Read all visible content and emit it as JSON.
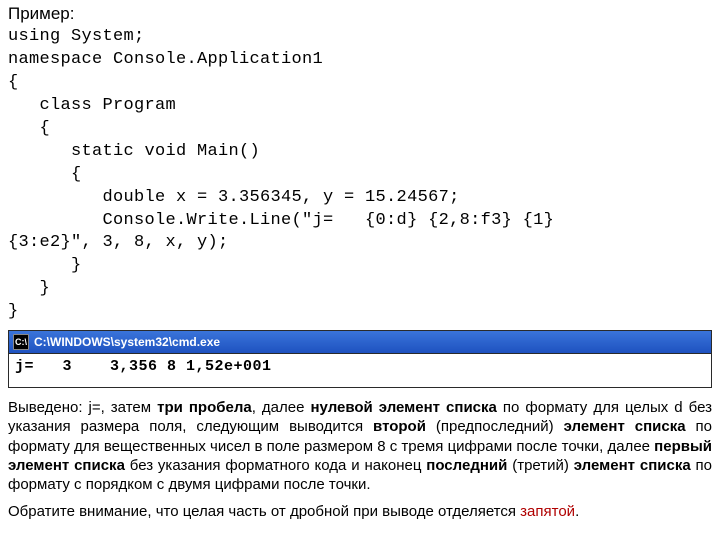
{
  "heading": "Пример:",
  "code": {
    "l1": "using System;",
    "l2": "namespace Console.Application1",
    "l3": "{",
    "l4": "   class Program",
    "l5": "   {",
    "l6": "      static void Main()",
    "l7": "      {",
    "l8": "         double x = 3.356345, y = 15.24567;",
    "l9": "         Console.Write.Line(\"j=   {0:d} {2,8:f3} {1}",
    "l10": "{3:e2}\", 3, 8, x, y);",
    "l11": "      }",
    "l12": "   }",
    "l13": "}"
  },
  "console": {
    "title": "C:\\WINDOWS\\system32\\cmd.exe",
    "icon_glyph": "C:\\",
    "output_line": "j=   3    3,356 8 1,52e+001"
  },
  "para1": {
    "t1": "Выведено: j=, затем ",
    "b1": "три пробела",
    "t2": ", далее ",
    "b2": "нулевой элемент списка",
    "t3": " по формату для целых d без указания размера поля, следующим выводится ",
    "b3": "второй",
    "t4": " (предпоследний) ",
    "b4": "элемент списка",
    "t5": " по формату для вещественных чисел в поле размером 8 с тремя цифрами после точки, далее ",
    "b5": "первый элемент списка",
    "t6": " без указания форматного кода и наконец ",
    "b6": "последний",
    "t7": " (третий) ",
    "b7": "элемент списка",
    "t8": " по формату с порядком с двумя цифрами после точки."
  },
  "para2": {
    "t1": "Обратите внимание, что целая часть от дробной при выводе отделяется ",
    "hl": "запятой",
    "t2": "."
  }
}
